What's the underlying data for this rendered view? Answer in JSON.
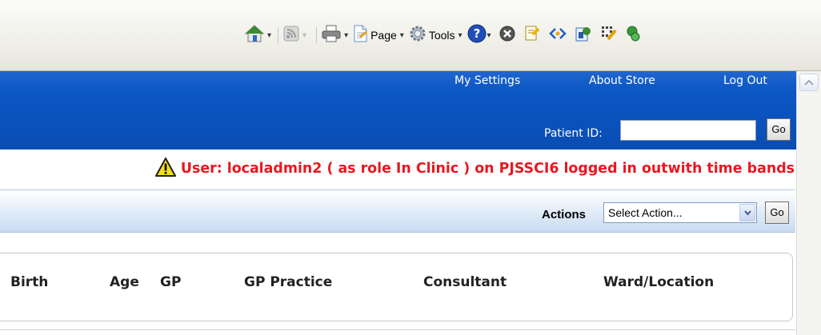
{
  "toolbar": {
    "page_label": "Page",
    "tools_label": "Tools",
    "dropdown_glyph": "▾",
    "icons": [
      "home-icon",
      "feeds-icon",
      "print-icon",
      "page-icon",
      "tools-gear-icon",
      "help-icon",
      "stop-icon",
      "research-icon",
      "accessibility-icon",
      "messenger-icon",
      "add-on-icon",
      "add-on-icon-2"
    ]
  },
  "header": {
    "links": {
      "settings": "My Settings",
      "about": "About Store",
      "logout": "Log Out"
    },
    "patient_id_label": "Patient ID:",
    "patient_id_value": "",
    "go_label": "Go",
    "accent": "#0b57c4"
  },
  "warning": {
    "icon": "warning-icon",
    "text": "User: localadmin2 ( as role In Clinic ) on PJSSCI6 logged in outwith time bands",
    "color": "#e8181f"
  },
  "actions": {
    "label": "Actions",
    "selected": "Select Action...",
    "go_label": "Go"
  },
  "table": {
    "columns": [
      "Birth",
      "Age",
      "GP",
      "GP Practice",
      "Consultant",
      "Ward/Location"
    ]
  }
}
